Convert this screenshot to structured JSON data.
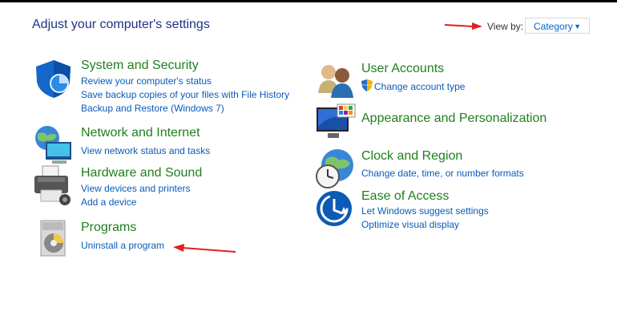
{
  "page": {
    "title": "Adjust your computer's settings"
  },
  "view_by": {
    "label": "View by:",
    "value": "Category"
  },
  "categories": {
    "system": {
      "title": "System and Security",
      "links": [
        "Review your computer's status",
        "Save backup copies of your files with File History",
        "Backup and Restore (Windows 7)"
      ],
      "icon": "shield-icon"
    },
    "network": {
      "title": "Network and Internet",
      "links": [
        "View network status and tasks"
      ],
      "icon": "network-globe-icon"
    },
    "hardware": {
      "title": "Hardware and Sound",
      "links": [
        "View devices and printers",
        "Add a device"
      ],
      "icon": "printer-icon"
    },
    "programs": {
      "title": "Programs",
      "links": [
        "Uninstall a program"
      ],
      "icon": "programs-disc-icon"
    },
    "users": {
      "title": "User Accounts",
      "links": [
        "Change account type"
      ],
      "icon": "users-icon"
    },
    "appearance": {
      "title": "Appearance and Personalization",
      "links": [],
      "icon": "monitor-palette-icon"
    },
    "clock": {
      "title": "Clock and Region",
      "links": [
        "Change date, time, or number formats"
      ],
      "icon": "clock-globe-icon"
    },
    "ease": {
      "title": "Ease of Access",
      "links": [
        "Let Windows suggest settings",
        "Optimize visual display"
      ],
      "icon": "ease-of-access-icon"
    }
  },
  "colors": {
    "title_blue": "#1e3287",
    "category_green": "#1f7f1f",
    "link_blue": "#0a5bb8",
    "annotation_red": "#e02020"
  }
}
